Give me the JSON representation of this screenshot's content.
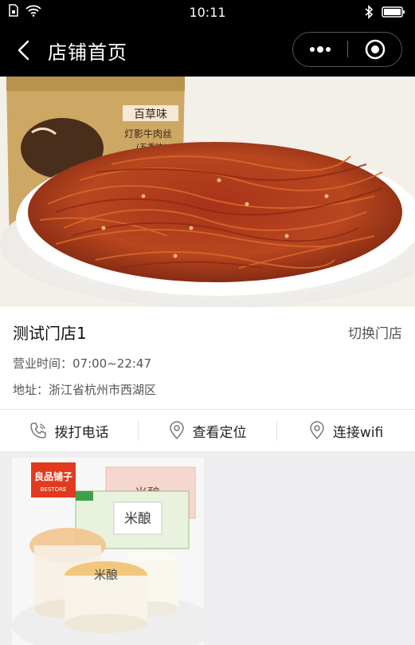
{
  "status_bar": {
    "time": "10:11",
    "icons": [
      "sim-icon",
      "wifi-icon",
      "bluetooth-icon",
      "battery-icon"
    ]
  },
  "nav": {
    "title": "店铺首页",
    "back_icon": "chevron-left-icon",
    "more_icon": "more-dots-icon",
    "close_icon": "target-close-icon"
  },
  "banner": {
    "slide_count": 2,
    "active_slide": 1,
    "package_text": "百草味",
    "package_subtext": "灯影牛肉丝",
    "package_flavor": "(五香味)"
  },
  "store": {
    "name": "测试门店1",
    "switch_label": "切换门店",
    "hours": "营业时间：07:00~22:47",
    "address": "地址：浙江省杭州市西湖区"
  },
  "actions": [
    {
      "label": "拨打电话",
      "icon": "phone-icon"
    },
    {
      "label": "查看定位",
      "icon": "location-pin-icon"
    },
    {
      "label": "连接wifi",
      "icon": "location-pin-icon"
    }
  ],
  "product": {
    "brand": "良品铺子",
    "brand_en": "BESTORE",
    "name": "米酿"
  },
  "colors": {
    "header_bg": "#000000",
    "page_bg": "#ffffff",
    "grid_bg": "#eeeef0",
    "brand_red": "#e23a1e"
  }
}
